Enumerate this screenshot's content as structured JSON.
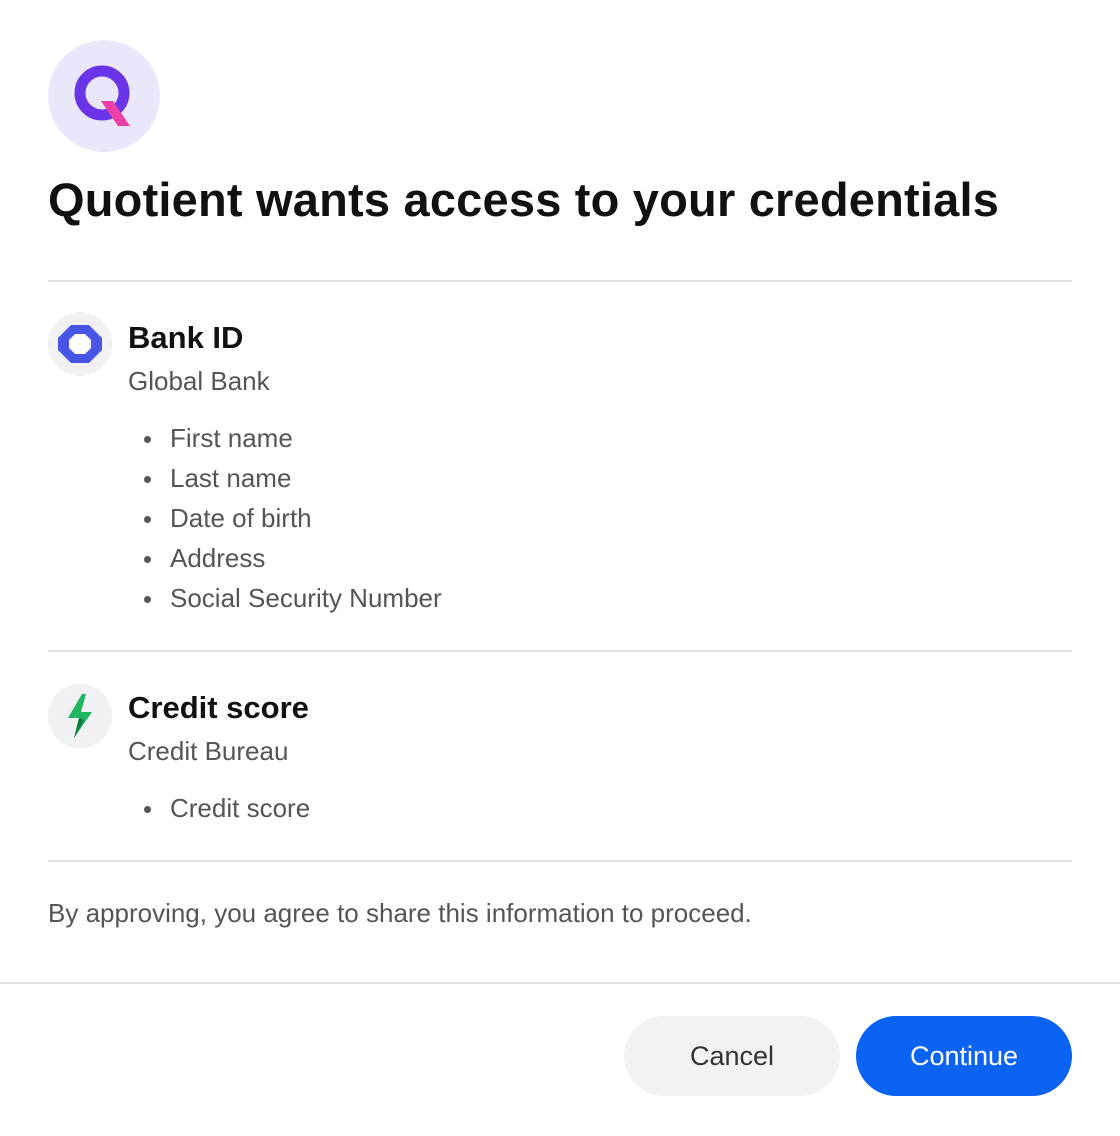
{
  "dialog": {
    "title": "Quotient wants access to your credentials",
    "app_logo_icon": "quotient-logo-icon",
    "colors": {
      "accent": "#0a63f2",
      "logo_purple": "#6a35e8",
      "logo_pink": "#ec3fa7",
      "bank_blue": "#4754e6",
      "credit_green": "#1fb561"
    }
  },
  "credentials": [
    {
      "icon": "bank-id-icon",
      "title": "Bank ID",
      "issuer": "Global Bank",
      "fields": [
        "First name",
        "Last name",
        "Date of birth",
        "Address",
        "Social Security Number"
      ]
    },
    {
      "icon": "credit-score-icon",
      "title": "Credit score",
      "issuer": "Credit Bureau",
      "fields": [
        "Credit score"
      ]
    }
  ],
  "consent_text": "By approving, you agree to share this information to proceed.",
  "actions": {
    "cancel_label": "Cancel",
    "continue_label": "Continue"
  }
}
